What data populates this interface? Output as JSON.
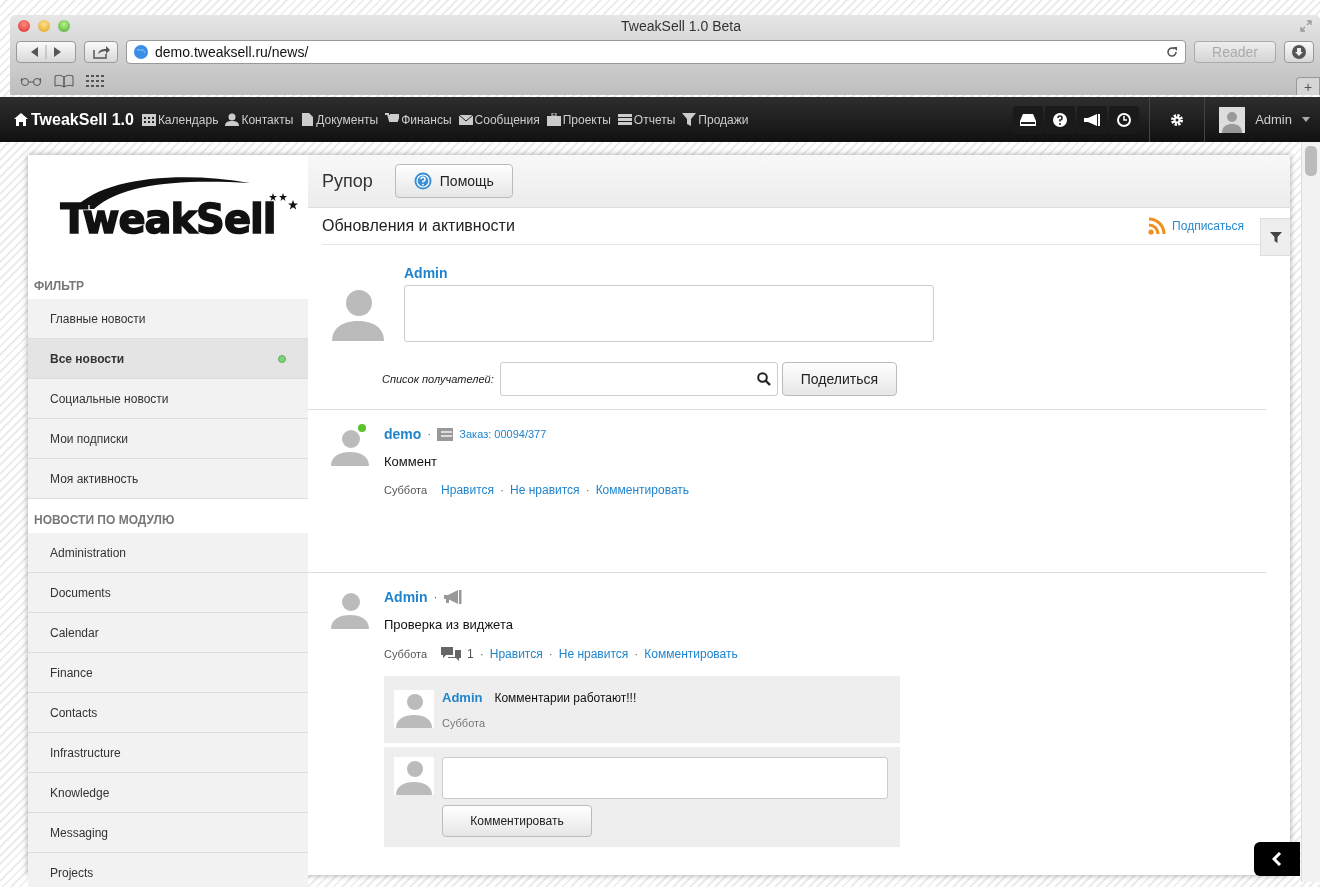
{
  "window": {
    "title": "TweakSell 1.0 Beta"
  },
  "browser": {
    "url": "demo.tweaksell.ru/news/",
    "reader": "Reader",
    "new_tab": "+"
  },
  "navbar": {
    "brand": "TweakSell 1.0",
    "items": [
      {
        "label": "Календарь"
      },
      {
        "label": "Контакты"
      },
      {
        "label": "Документы"
      },
      {
        "label": "Финансы"
      },
      {
        "label": "Сообщения"
      },
      {
        "label": "Проекты"
      },
      {
        "label": "Отчеты"
      },
      {
        "label": "Продажи"
      }
    ],
    "user": "Admin"
  },
  "logo": "TweakSell",
  "sidebar": [
    {
      "heading": "ФИЛЬТР",
      "items": [
        {
          "label": "Главные новости",
          "selected": false
        },
        {
          "label": "Все новости",
          "selected": true
        },
        {
          "label": "Социальные новости",
          "selected": false
        },
        {
          "label": "Мои подписки",
          "selected": false
        },
        {
          "label": "Моя активность",
          "selected": false
        }
      ]
    },
    {
      "heading": "НОВОСТИ ПО МОДУЛЮ",
      "items": [
        {
          "label": "Administration",
          "selected": false
        },
        {
          "label": "Documents",
          "selected": false
        },
        {
          "label": "Calendar",
          "selected": false
        },
        {
          "label": "Finance",
          "selected": false
        },
        {
          "label": "Contacts",
          "selected": false
        },
        {
          "label": "Infrastructure",
          "selected": false
        },
        {
          "label": "Knowledge",
          "selected": false
        },
        {
          "label": "Messaging",
          "selected": false
        },
        {
          "label": "Projects",
          "selected": false
        }
      ]
    }
  ],
  "page": {
    "title": "Рупор",
    "help_button": "Помощь",
    "section_title": "Обновления и активности",
    "subscribe": "Подписаться"
  },
  "composer": {
    "author": "Admin",
    "recipients_label": "Список получателей:",
    "share_button": "Поделиться"
  },
  "separator": "·",
  "posts": [
    {
      "author": "demo",
      "online": true,
      "kind": "order",
      "reference": "Заказ: 00094/377",
      "text": "Коммент",
      "day": "Суббота",
      "actions": [
        "Нравится",
        "Не нравится",
        "Комментировать"
      ]
    },
    {
      "author": "Admin",
      "online": false,
      "kind": "announcement",
      "comment_count": "1",
      "text": "Проверка из виджета",
      "day": "Суббота",
      "actions": [
        "Нравится",
        "Не нравится",
        "Комментировать"
      ],
      "comments": [
        {
          "author": "Admin",
          "text": "Комментарии работают!!!",
          "day": "Суббота"
        }
      ],
      "reply_button": "Комментировать"
    }
  ]
}
